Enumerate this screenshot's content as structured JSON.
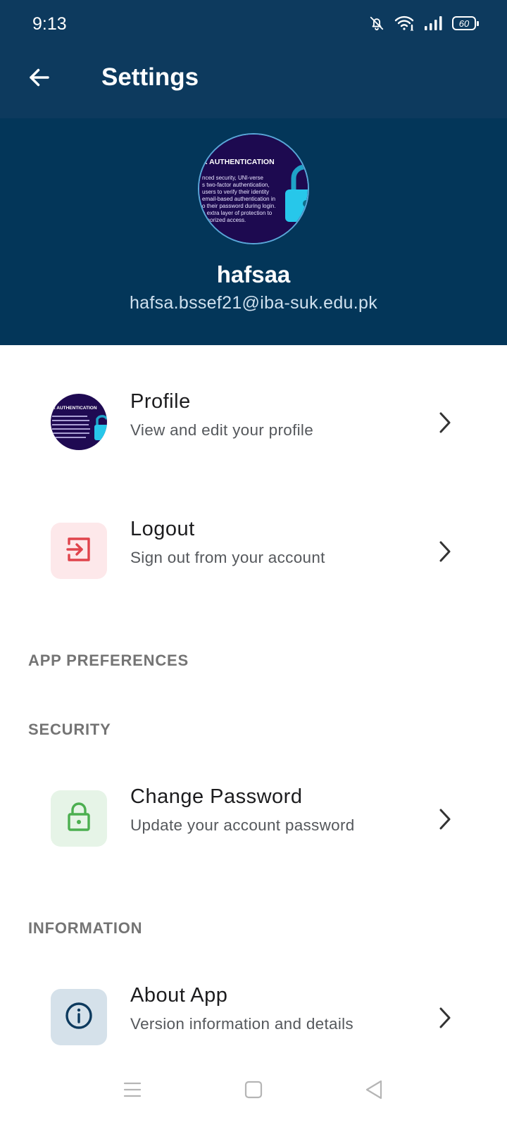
{
  "status_bar": {
    "time": "9:13",
    "battery": "60",
    "icons": [
      "bell-muted-icon",
      "wifi-icon",
      "signal-icon",
      "battery-icon"
    ]
  },
  "app_bar": {
    "title": "Settings",
    "back_icon": "arrow-left-icon"
  },
  "profile": {
    "name": "hafsaa",
    "email": "hafsa.bssef21@iba-suk.edu.pk",
    "avatar_image": {
      "heading": "R AUTHENTICATION",
      "lines": [
        "nced security, UNI-verse",
        "s two-factor authentication,",
        "users to verify their identity",
        "email-based authentication in",
        "o their password during login.",
        "n extra layer of protection to",
        "uthorized access."
      ]
    }
  },
  "items": {
    "profile": {
      "title": "Profile",
      "subtitle": "View and edit your profile",
      "icon": "avatar-image"
    },
    "logout": {
      "title": "Logout",
      "subtitle": "Sign out from your account",
      "icon": "logout-icon"
    },
    "change_password": {
      "title": "Change Password",
      "subtitle": "Update your account password",
      "icon": "lock-icon"
    },
    "about": {
      "title": "About App",
      "subtitle": "Version information and details",
      "icon": "info-icon"
    }
  },
  "sections": {
    "app_preferences": "APP PREFERENCES",
    "security": "SECURITY",
    "information": "INFORMATION"
  },
  "colors": {
    "header": "#033659",
    "app_bar": "#0d3a5e",
    "logout_bg": "#fde8ea",
    "logout_fg": "#e0444c",
    "lock_bg": "#e6f4e7",
    "lock_fg": "#4caf50",
    "info_bg": "#d5e1ea",
    "info_fg": "#0d3a5e"
  },
  "nav_bar": [
    "menu-icon",
    "home-square-icon",
    "back-triangle-icon"
  ]
}
